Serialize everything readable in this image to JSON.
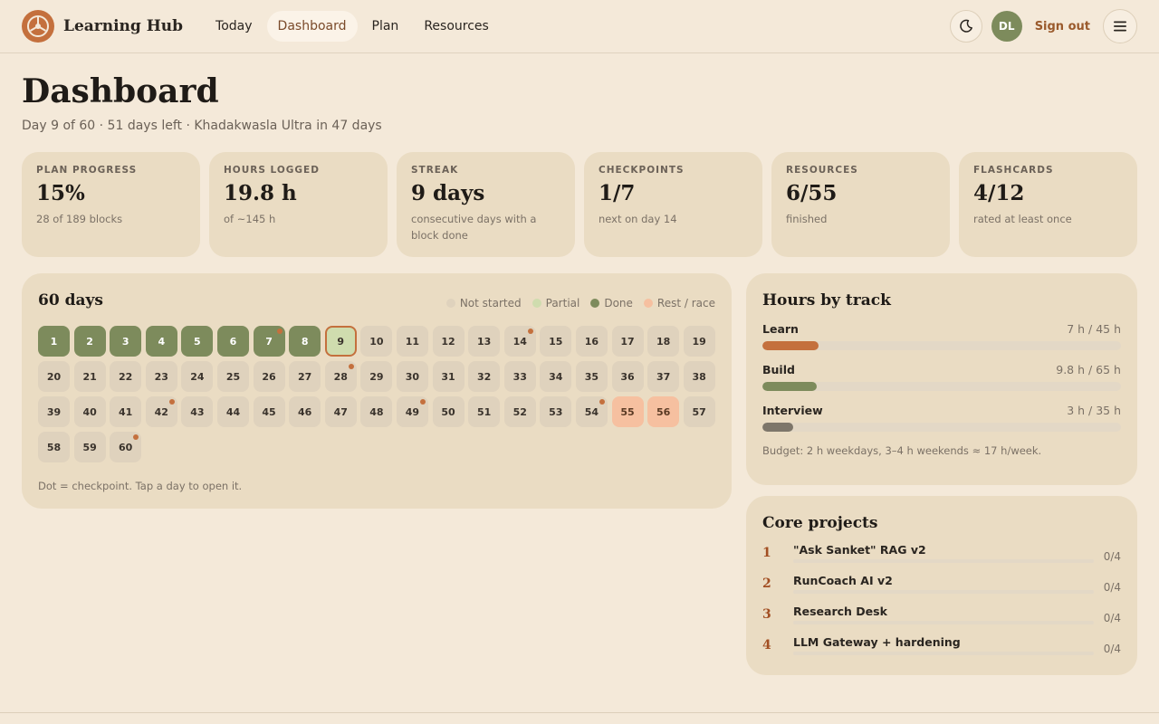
{
  "header": {
    "brand": "Learning Hub",
    "nav": [
      {
        "label": "Today",
        "active": false
      },
      {
        "label": "Dashboard",
        "active": true
      },
      {
        "label": "Plan",
        "active": false
      },
      {
        "label": "Resources",
        "active": false
      }
    ],
    "avatar": "DL",
    "sign_out": "Sign out",
    "icons": [
      "theme-toggle-moon-icon",
      "menu-hamburger-icon"
    ]
  },
  "page": {
    "title": "Dashboard",
    "subtitle": "Day 9 of 60 · 51 days left · Khadakwasla Ultra in 47 days"
  },
  "stats": [
    {
      "label": "PLAN PROGRESS",
      "value": "15%",
      "sub": "28 of 189 blocks"
    },
    {
      "label": "HOURS LOGGED",
      "value": "19.8 h",
      "sub": "of ~145 h"
    },
    {
      "label": "STREAK",
      "value": "9 days",
      "sub": "consecutive days with a block done"
    },
    {
      "label": "CHECKPOINTS",
      "value": "1/7",
      "sub": "next on day 14"
    },
    {
      "label": "RESOURCES",
      "value": "6/55",
      "sub": "finished"
    },
    {
      "label": "FLASHCARDS",
      "value": "4/12",
      "sub": "rated at least once"
    }
  ],
  "days": {
    "title": "60 days",
    "legend": [
      {
        "label": "Not started",
        "color": "#dfd2bd"
      },
      {
        "label": "Partial",
        "color": "#cfdcae"
      },
      {
        "label": "Done",
        "color": "#7d8b5c"
      },
      {
        "label": "Rest / race",
        "color": "#f6c0a0"
      }
    ],
    "total": 60,
    "done": [
      1,
      2,
      3,
      4,
      5,
      6,
      7,
      8
    ],
    "today": 9,
    "rest": [
      55,
      56
    ],
    "checkpoints": [
      7,
      14,
      28,
      42,
      49,
      54,
      60
    ],
    "note": "Dot = checkpoint. Tap a day to open it."
  },
  "tracks": {
    "title": "Hours by track",
    "items": [
      {
        "name": "Learn",
        "value": "7 h / 45 h",
        "progress": 0.156,
        "color": "#c4703d"
      },
      {
        "name": "Build",
        "value": "9.8 h / 65 h",
        "progress": 0.151,
        "color": "#7d8b5c"
      },
      {
        "name": "Interview",
        "value": "3 h / 35 h",
        "progress": 0.086,
        "color": "#7d766a"
      }
    ],
    "budget": "Budget: 2 h weekdays, 3–4 h weekends ≈ 17 h/week."
  },
  "projects": {
    "title": "Core projects",
    "items": [
      {
        "num": "1",
        "name": "\"Ask Sanket\" RAG v2",
        "count": "0/4"
      },
      {
        "num": "2",
        "name": "RunCoach AI v2",
        "count": "0/4"
      },
      {
        "num": "3",
        "name": "Research Desk",
        "count": "0/4"
      },
      {
        "num": "4",
        "name": "LLM Gateway + hardening",
        "count": "0/4"
      }
    ]
  }
}
